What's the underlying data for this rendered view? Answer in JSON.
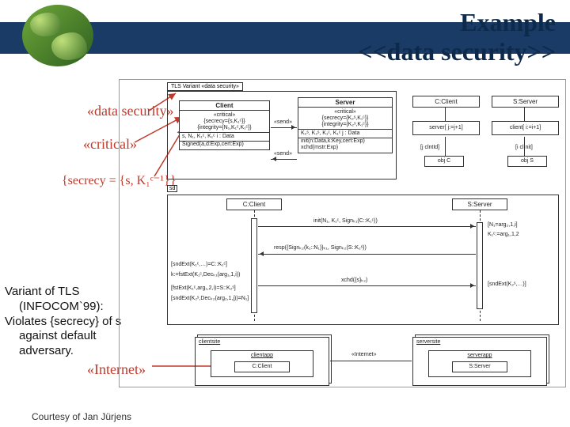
{
  "header": {
    "title_line1": "Example",
    "title_line2": "<<data security>>"
  },
  "annotations": {
    "data_security": "«data security»",
    "critical": "«critical»",
    "secrecy_formula": "{secrecy = {s, K₁ᶜ⁻¹}}",
    "internet": "«Internet»"
  },
  "side_text": {
    "line1": "Variant of TLS",
    "line2": "(INFOCOM`99):",
    "line3": "Violates {secrecy} of s",
    "line4": "against default",
    "line5": "adversary."
  },
  "diagram": {
    "top_package_label": "TLS Variant    «data security»",
    "client_box": {
      "title": "Client",
      "stereo": "«critical»",
      "secrecy": "{secrecy={s,K₁ᶜ}}",
      "integrity": "{integrity={N₁,K₁ᶜ,K₁ᶜ}}",
      "attrs": "s, N₁, K₁ᶜ, K₁ᶜ    i : Data",
      "ops": "Signed(a,d:Exp,cert:Exp)"
    },
    "server_box": {
      "title": "Server",
      "stereo": "«critical»",
      "secrecy": "{secrecy={K₂ˢ,K₁ᶜ}}",
      "integrity": "{integrity={K₂ˢ,K₁ᶜ}}",
      "attrs": "K₂ˢ, K₂ˢ, K₁ᶜ, K₁ᶜ    j : Data",
      "ops": "init(n:Data,k:Key,cert:Exp)\nxchd(mstr:Exp)"
    },
    "send_rcv": {
      "sends": "«send»",
      "rcvs": "«send»"
    },
    "actors": {
      "c_client": "C:Client",
      "s_server": "S:Server",
      "arrow_hdr_l": "server[ j:=j+1]",
      "arrow_hdr_r": "client[ i:=i+1]",
      "link_l": "[j clntId]",
      "link_r": "[i clInit]",
      "obj_l": "obj C",
      "obj_r": "obj S"
    },
    "sequence": {
      "sd_label": "sd",
      "left": "C:Client",
      "right": "S:Server",
      "msg1": "init(N₁, K₁ᶜ, Signₖ₁(C::K₁ᶜ))",
      "resp1": "resp({Signₖ₂(k₂::N₁)}ₖ₁, Signₖ₂(S::K₂ˢ))",
      "note_r1": "[N₁=arg₂,1,i]",
      "note_r2": "K₁ᶜ:=arg₁,1,2",
      "msg2": "xchd({s}ₖ₂)",
      "guard1": "[sndExt(K₁ᶜ,…)=C::K₁ᶜ]",
      "guard2": "k:=fstExt(K₁ᶜ,Decₖ₁(arg₁,1,i))",
      "guard3": "[fstExt(K₁ᶜ,arg₁,2,i)=S::K₂ˢ]",
      "guard4": "[sndExt(K₂ˢ,Decₖ₂(arg₂,1,j))=N₁]",
      "note_r3": "[sndExt(K₂ˢ,…)]"
    },
    "deployment": {
      "client_site": "clientsite",
      "server_site": "serversite",
      "client_app": "clientapp",
      "server_app": "serverapp",
      "internet": "«Internet»",
      "c": "C:Client",
      "s": "S:Server"
    }
  },
  "footer": "Courtesy of Jan Jürjens"
}
